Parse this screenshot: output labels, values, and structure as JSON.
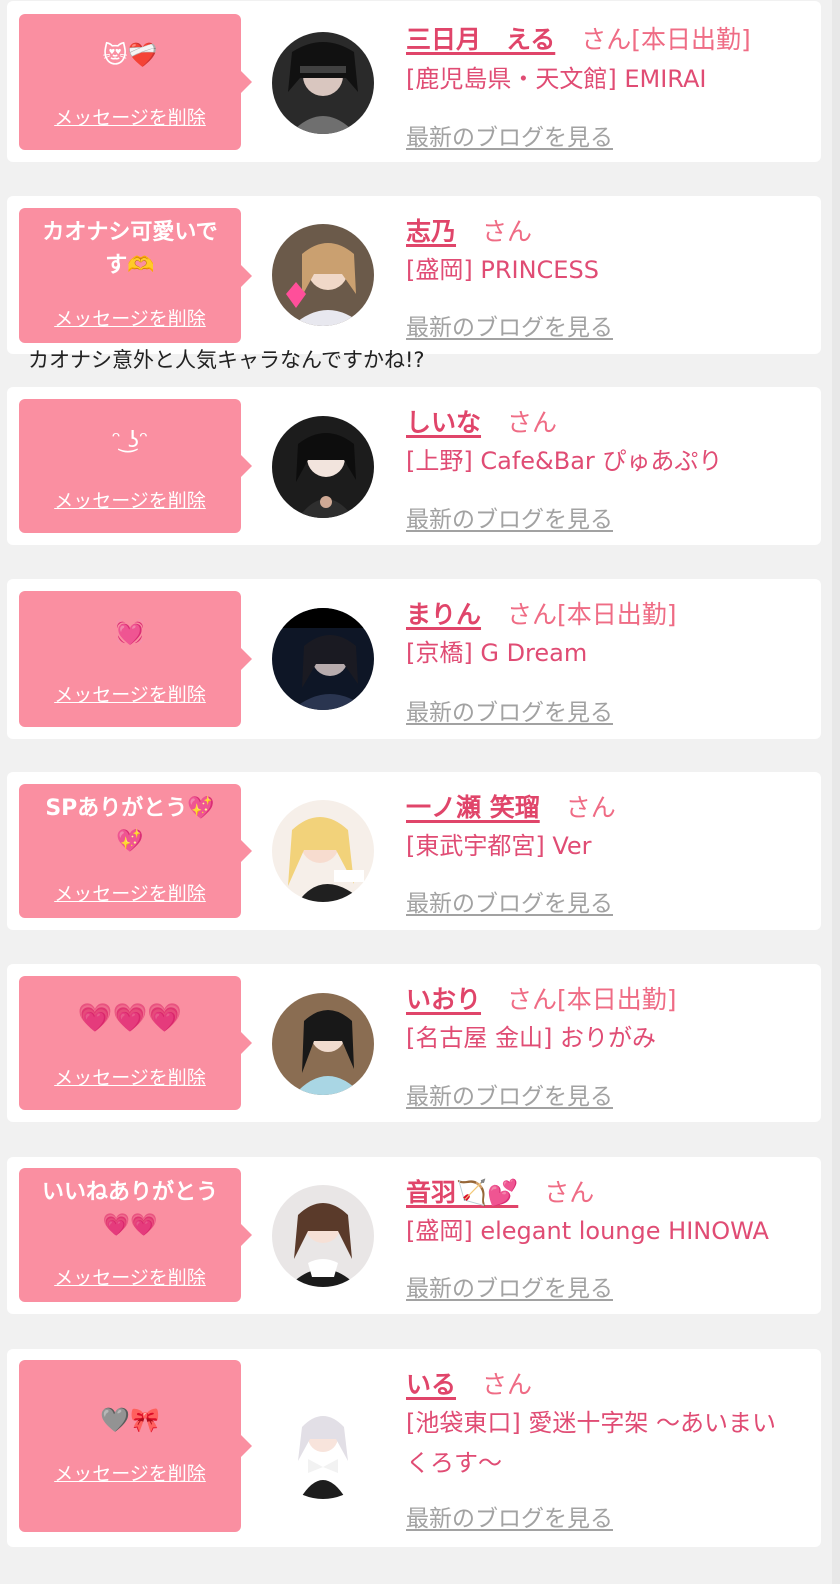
{
  "delete_label": "メッセージを削除",
  "blog_label": "最新のブログを見る",
  "san_label": "さん",
  "colors": {
    "bubble": "#fa8fa1",
    "name": "#e0456a",
    "shop": "#e04c74",
    "blog": "#a2a2a2",
    "card": "#ffffff",
    "page": "#f1f1f1"
  },
  "items": [
    {
      "message": "😻❤️‍🩹",
      "name": "三日月　える",
      "suffix": "さん[本日出勤]",
      "shop": "[鹿児島県・天文館] EMIRAI",
      "avatar": "dark-portrait"
    },
    {
      "message": "カオナシ可愛いで\nす🫶",
      "name": "志乃",
      "suffix": "さん",
      "shop": "[盛岡] PRINCESS",
      "avatar": "hair-portrait"
    },
    {
      "message": "ᵔ ͜ʖᵔ",
      "name": "しいな",
      "suffix": "さん",
      "shop": "[上野] Cafe&Bar ぴゅあぷり",
      "avatar": "dark-portrait"
    },
    {
      "message": "💓",
      "name": "まりん",
      "suffix": "さん[本日出勤]",
      "shop": "[京橋] G Dream",
      "avatar": "night-portrait"
    },
    {
      "message": "SPありがとう💖\n💖",
      "name": "一ノ瀬 笑瑠",
      "suffix": "さん",
      "shop": "[東武宇都宮] Ver",
      "avatar": "blonde-portrait"
    },
    {
      "message": "💗💗💗",
      "name": "いおり",
      "suffix": "さん[本日出勤]",
      "shop": "[名古屋 金山] おりがみ",
      "avatar": "brown-portrait"
    },
    {
      "message": "いいねありがとう\n💗💗",
      "name": "音羽🏹💕",
      "suffix": "さん",
      "shop": "[盛岡] elegant lounge HINOWA",
      "avatar": "light-portrait"
    },
    {
      "message": "🩶🎀",
      "name": "いる",
      "suffix": "さん",
      "shop": "[池袋東口] 愛迷十字架 ～あいまいくろす～",
      "avatar": "white-portrait"
    }
  ],
  "comment": "カオナシ意外と人気キャラなんですかね!?"
}
